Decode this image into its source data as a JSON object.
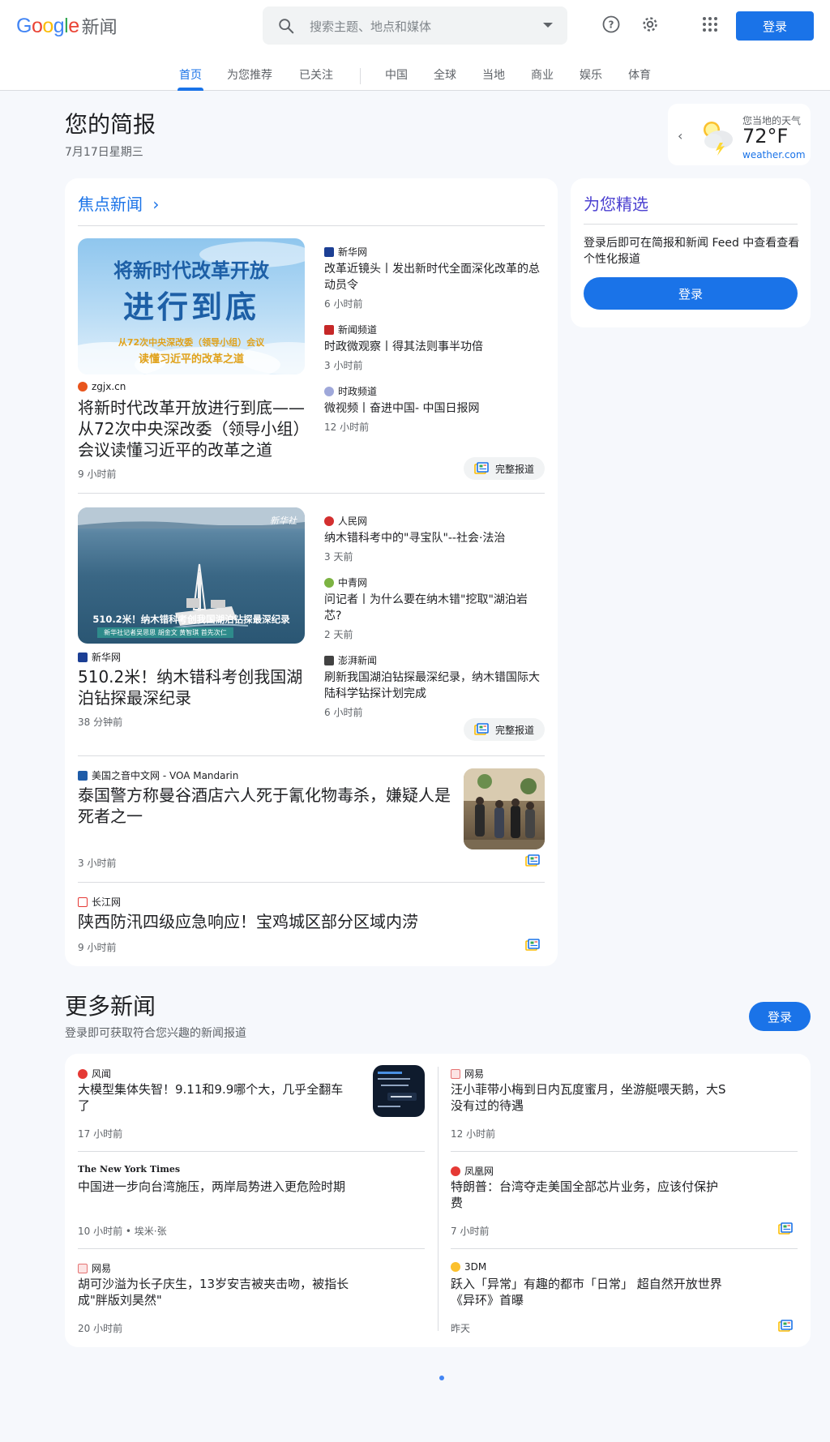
{
  "header": {
    "logo_word": "Google",
    "logo_suffix": "新闻",
    "search_placeholder": "搜索主题、地点和媒体",
    "signin_label": "登录",
    "help_icon": "help-icon",
    "settings_icon": "gear-icon",
    "apps_icon": "apps-grid-icon"
  },
  "nav": {
    "items": [
      {
        "label": "首页",
        "active": true
      },
      {
        "label": "为您推荐"
      },
      {
        "label": "已关注"
      },
      {
        "label": "中国"
      },
      {
        "label": "全球"
      },
      {
        "label": "当地"
      },
      {
        "label": "商业"
      },
      {
        "label": "娱乐"
      },
      {
        "label": "体育"
      }
    ]
  },
  "briefing": {
    "title": "您的简报",
    "date": "7月17日星期三"
  },
  "weather": {
    "label": "您当地的天气",
    "temp": "72°F",
    "source": "weather.com"
  },
  "top_stories": {
    "title": "焦点新闻",
    "clusters": [
      {
        "main": {
          "image_text_1": "将新时代改革开放",
          "image_text_2": "进行到底",
          "image_text_3": "从72次中央深改委（领导小组）会议",
          "image_text_4": "读懂习近平的改革之道",
          "source": "zgjx.cn",
          "headline": "将新时代改革开放进行到底——从72次中央深改委（领导小组）会议读懂习近平的改革之道",
          "time": "9 小时前"
        },
        "related": [
          {
            "source": "新华网",
            "headline": "改革近镜头丨发出新时代全面深化改革的总动员令",
            "time": "6 小时前"
          },
          {
            "source": "新闻频道",
            "headline": "时政微观察丨得其法则事半功倍",
            "time": "3 小时前"
          },
          {
            "source": "时政频道",
            "headline": "微视频丨奋进中国- 中国日报网",
            "time": "12 小时前"
          }
        ],
        "full_coverage": "完整报道"
      },
      {
        "main": {
          "image_caption": "510.2米！纳木错科考创我国湖泊钻探最深纪录",
          "image_sub": "新华社记者吴思思 胡金文 黄智琪 首先次仁",
          "image_watermark": "新华社",
          "source": "新华网",
          "headline": "510.2米！纳木错科考创我国湖泊钻探最深纪录",
          "time": "38 分钟前"
        },
        "related": [
          {
            "source": "人民网",
            "headline": "纳木错科考中的\"寻宝队\"--社会·法治",
            "time": "3 天前"
          },
          {
            "source": "中青网",
            "headline": "问记者丨为什么要在纳木错\"挖取\"湖泊岩芯?",
            "time": "2 天前"
          },
          {
            "source": "澎湃新闻",
            "headline": "刷新我国湖泊钻探最深纪录，纳木错国际大陆科学钻探计划完成",
            "time": "6 小时前"
          }
        ],
        "full_coverage": "完整报道"
      }
    ],
    "singles": [
      {
        "source": "美国之音中文网 - VOA Mandarin",
        "headline": "泰国警方称曼谷酒店六人死于氰化物毒杀，嫌疑人是死者之一",
        "time": "3 小时前"
      },
      {
        "source": "长江网",
        "headline": "陕西防汛四级应急响应！宝鸡城区部分区域内涝",
        "time": "9 小时前"
      }
    ]
  },
  "picks": {
    "title": "为您精选",
    "text": "登录后即可在简报和新闻 Feed 中查看查看个性化报道",
    "button": "登录"
  },
  "more_news": {
    "title": "更多新闻",
    "subtitle": "登录即可获取符合您兴趣的新闻报道",
    "signin": "登录",
    "left": [
      {
        "source": "风闻",
        "headline": "大模型集体失智！9.11和9.9哪个大，几乎全翻车了",
        "time": "17 小时前"
      },
      {
        "source": "The New York Times",
        "headline": "中国进一步向台湾施压，两岸局势进入更危险时期",
        "time": "10 小时前 • 埃米·张"
      },
      {
        "source": "网易",
        "headline": "胡可沙溢为长子庆生，13岁安吉被夹击吻，被指长成\"胖版刘昊然\"",
        "time": "20 小时前"
      }
    ],
    "right": [
      {
        "source": "网易",
        "headline": "汪小菲带小梅到日内瓦度蜜月，坐游艇喂天鹅，大S没有过的待遇",
        "time": "12 小时前"
      },
      {
        "source": "凤凰网",
        "headline": "特朗普：台湾夺走美国全部芯片业务，应该付保护费",
        "time": "7 小时前"
      },
      {
        "source": "3DM",
        "headline": "跃入「异常」有趣的都市「日常」 超自然开放世界《异环》首曝",
        "time": "昨天"
      }
    ]
  },
  "colors": {
    "accent": "#1a73e8",
    "picks_title": "#4a3fd0",
    "background": "#f6f8fc"
  }
}
